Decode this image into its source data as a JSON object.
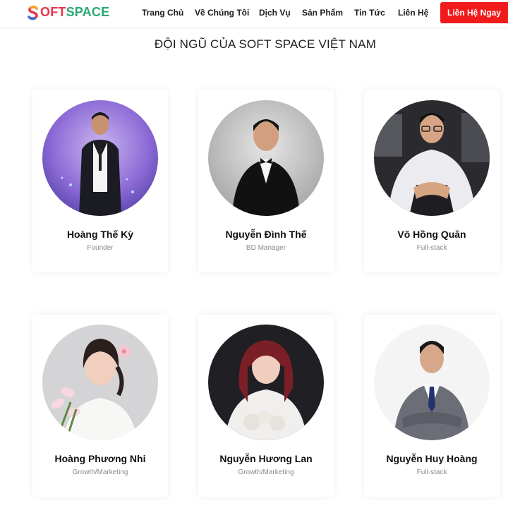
{
  "brand": {
    "logo_text": "SOFTSPACE",
    "colors": {
      "red": "#e5354e",
      "blue": "#3c6fd8",
      "green": "#2ba776"
    }
  },
  "nav": {
    "items": [
      {
        "label": "Trang Chủ"
      },
      {
        "label": "Về Chúng Tôi"
      },
      {
        "label": "Dịch Vụ"
      },
      {
        "label": "Sản Phẩm"
      },
      {
        "label": "Tin Tức"
      },
      {
        "label": "Liên Hệ"
      }
    ],
    "cta_label": "Liên Hệ Ngay",
    "cta_color": "#f21b1b"
  },
  "team": {
    "title": "ĐỘI NGŨ CỦA SOFT SPACE VIỆT NAM",
    "members": [
      {
        "name": "Hoàng Thế Kỳ",
        "role": "Founder"
      },
      {
        "name": "Nguyễn Đình Thế",
        "role": "BD Manager"
      },
      {
        "name": "Võ Hồng Quân",
        "role": "Full-stack"
      },
      {
        "name": "Hoàng Phương Nhi",
        "role": "Growth/Marketing"
      },
      {
        "name": "Nguyễn Hương Lan",
        "role": "Growth/Marketing"
      },
      {
        "name": "Nguyễn Huy Hoàng",
        "role": "Full-stack"
      }
    ]
  }
}
